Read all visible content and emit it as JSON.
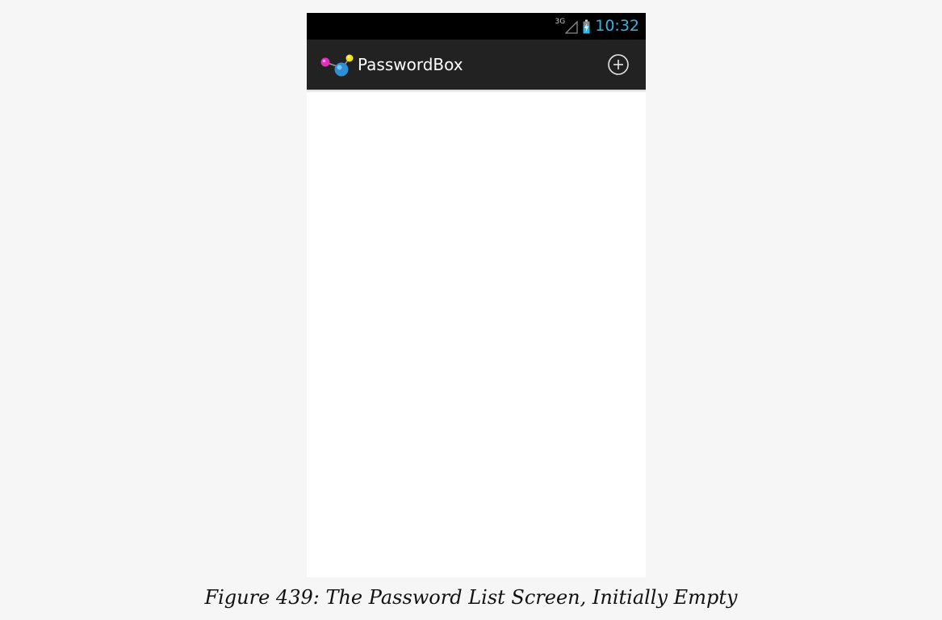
{
  "status_bar": {
    "network_type": "3G",
    "time": "10:32",
    "signal_icon": "signal-icon",
    "battery_icon": "battery-charging-icon"
  },
  "action_bar": {
    "app_icon": "app-logo-icon",
    "title": "PasswordBox",
    "add_icon": "add-circle-icon"
  },
  "password_list": {
    "items": []
  },
  "caption": "Figure 439: The Password List Screen, Initially Empty",
  "colors": {
    "status_bar_bg": "#000000",
    "action_bar_bg": "#222222",
    "clock_accent": "#33b5e5",
    "page_bg": "#f6f6f6"
  }
}
